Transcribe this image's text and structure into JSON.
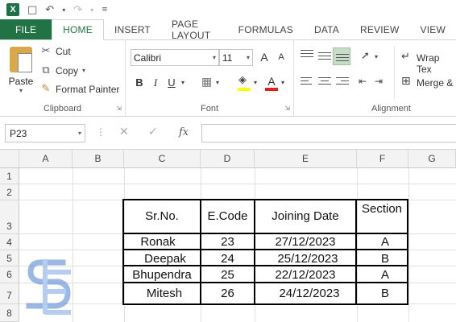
{
  "ribbon": {
    "tabs": [
      "FILE",
      "HOME",
      "INSERT",
      "PAGE LAYOUT",
      "FORMULAS",
      "DATA",
      "REVIEW",
      "VIEW"
    ],
    "active_tab": "HOME",
    "clipboard": {
      "paste": "Paste",
      "cut": "Cut",
      "copy": "Copy",
      "format_painter": "Format Painter",
      "label": "Clipboard"
    },
    "font": {
      "name": "Calibri",
      "size": "11",
      "label": "Font",
      "bold": "B",
      "italic": "I",
      "underline": "U",
      "grow": "A",
      "shrink": "A",
      "color_letter": "A"
    },
    "alignment": {
      "wrap_text": "Wrap Tex",
      "merge": "Merge &",
      "label": "Alignment"
    }
  },
  "formula_bar": {
    "name_box": "P23",
    "fx": "fx",
    "cancel": "✕",
    "enter": "✓",
    "value": ""
  },
  "grid": {
    "columns": [
      "A",
      "B",
      "C",
      "D",
      "E",
      "F",
      "G"
    ],
    "rows": [
      "1",
      "2",
      "3",
      "4",
      "5",
      "6",
      "7",
      "8"
    ],
    "table": {
      "headers": [
        "Sr.No.",
        "E.Code",
        "Joining Date",
        "Section"
      ],
      "rows": [
        [
          "Ronak",
          "23",
          "27/12/2023",
          "A"
        ],
        [
          "Deepak",
          "24",
          "25/12/2023",
          "B"
        ],
        [
          "Bhupendra",
          "25",
          "22/12/2023",
          "A"
        ],
        [
          "Mitesh",
          "26",
          "24/12/2023",
          "B"
        ]
      ]
    }
  },
  "colors": {
    "accent": "#217346",
    "watermark": "#4a7fd0"
  }
}
